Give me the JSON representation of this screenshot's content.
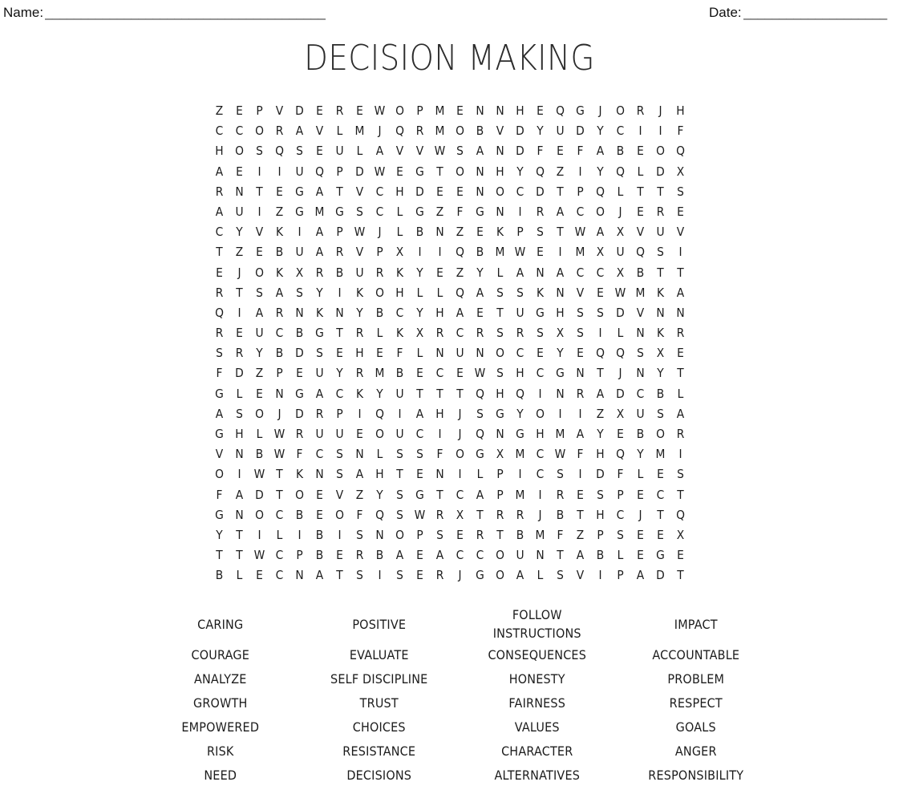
{
  "header": {
    "name_label": "Name:",
    "name_rule": "_______________________________________",
    "date_label": "Date:",
    "date_rule": "____________________"
  },
  "title": "DECISION MAKING",
  "puzzle": {
    "rows": 24,
    "cols": 24,
    "grid": [
      "ZEPVDEREWOPMENNHEQGJORJH",
      "CCORAVLMJQRMOBVDYUDYCIIF",
      "HOSQSEULAVVWSANDFEFABEOQ",
      "AEIIUQPDWEGTONHYQZIYQLDX",
      "RNTEGATVCHDEENOCDTPQLTTS",
      "AUIZGMGSCLGZFGNIRACOJERE",
      "CYVKIAPWJLBNZEKPSTWAXVUV",
      "TZEBUARVPXIIQBMWEIMXUQSI",
      "EJOKXRBURKYEZYLANACCXBTT",
      "RTSASYIKOHLLQASSKNVEWMKA",
      "QIARNKNYBCYHAETUGHSSDVNN",
      "REUCBGTRLKXRCRSRSXSILNKR",
      "SRYBDSEHEFLNUNOCEYEQQSXE",
      "FDZPEUYRMBECEWSHCGNTJNYT",
      "GLENGACKYUTTTQHQINRADCBL",
      "ASOJDRPIQIAHJSGYOIIZXUSA",
      "GHLWRUUEOUCIJQNGHMAYEBOR",
      "VNBWFCSNLSSFOGXMCWFHQYMI",
      "OIWTKNSAHTENILPICSIDFLES",
      "FADTOEVZYSGTCAPMIRESPECT",
      "GNOCBEOFQSWRXTRRJBTHCJTQ",
      "YTILIBISNOPSERTBMFZPSEEX",
      "TTWCPBERBAEACCOUNTABLEGE",
      "BLECNATSISERJGOALSVIPADT"
    ]
  },
  "word_list": {
    "rows": [
      [
        "CARING",
        "POSITIVE",
        "FOLLOW\nINSTRUCTIONS",
        "IMPACT"
      ],
      [
        "COURAGE",
        "EVALUATE",
        "CONSEQUENCES",
        "ACCOUNTABLE"
      ],
      [
        "ANALYZE",
        "SELF DISCIPLINE",
        "HONESTY",
        "PROBLEM"
      ],
      [
        "GROWTH",
        "TRUST",
        "FAIRNESS",
        "RESPECT"
      ],
      [
        "EMPOWERED",
        "CHOICES",
        "VALUES",
        "GOALS"
      ],
      [
        "RISK",
        "RESISTANCE",
        "CHARACTER",
        "ANGER"
      ],
      [
        "NEED",
        "DECISIONS",
        "ALTERNATIVES",
        "RESPONSIBILITY"
      ]
    ]
  },
  "colors": {
    "ink": "#1c1c1c",
    "title_ink": "#2b2b2b",
    "rule": "#3a3a3a",
    "paper": "#ffffff"
  }
}
